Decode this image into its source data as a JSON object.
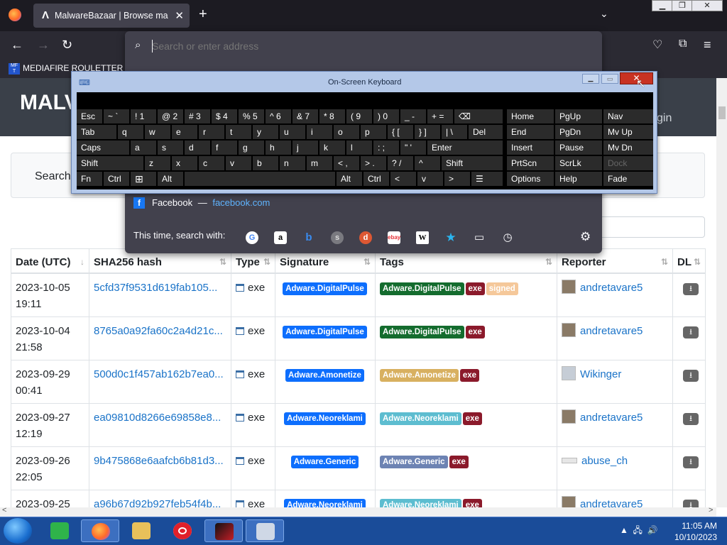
{
  "browser": {
    "tab_title": "MalwareBazaar | Browse malwa",
    "tab_favicon": "Λ",
    "address_placeholder": "Search or enter address",
    "bookmark": "MEDIAFIRE ROULETTER"
  },
  "page": {
    "brand_partial": "MALV",
    "login_partial": "gin",
    "search_label": "Search",
    "table": {
      "headers": [
        "Date (UTC)",
        "SHA256 hash",
        "Type",
        "Signature",
        "Tags",
        "Reporter",
        "DL"
      ],
      "rows": [
        {
          "date": "2023-10-05",
          "time": "19:11",
          "hash": "5cfd37f9531d619fab105...",
          "type": "exe",
          "signature": "Adware.DigitalPulse",
          "tags": [
            "Adware.DigitalPulse",
            "exe",
            "signed"
          ],
          "reporter": "andretavare5"
        },
        {
          "date": "2023-10-04",
          "time": "21:58",
          "hash": "8765a0a92fa60c2a4d21c...",
          "type": "exe",
          "signature": "Adware.DigitalPulse",
          "tags": [
            "Adware.DigitalPulse",
            "exe"
          ],
          "reporter": "andretavare5"
        },
        {
          "date": "2023-09-29",
          "time": "00:41",
          "hash": "500d0c1f457ab162b7ea0...",
          "type": "exe",
          "signature": "Adware.Amonetize",
          "tags": [
            "Adware.Amonetize",
            "exe"
          ],
          "reporter": "Wikinger"
        },
        {
          "date": "2023-09-27",
          "time": "12:19",
          "hash": "ea09810d8266e69858e8...",
          "type": "exe",
          "signature": "Adware.Neoreklami",
          "tags": [
            "Adware.Neoreklami",
            "exe"
          ],
          "reporter": "andretavare5"
        },
        {
          "date": "2023-09-26",
          "time": "22:05",
          "hash": "9b475868e6aafcb6b81d3...",
          "type": "exe",
          "signature": "Adware.Generic",
          "tags": [
            "Adware.Generic",
            "exe"
          ],
          "reporter": "abuse_ch"
        },
        {
          "date": "2023-09-25",
          "time": "",
          "hash": "a96b67d92b927feb54f4b...",
          "type": "exe",
          "signature": "Adware.Neoreklami",
          "tags": [
            "Adware.Neoreklami",
            "exe"
          ],
          "reporter": "andretavare5"
        }
      ]
    }
  },
  "dropdown": {
    "suggestion_name": "Facebook",
    "suggestion_sep": "—",
    "suggestion_url": "facebook.com",
    "search_with": "This time, search with:"
  },
  "osk": {
    "title": "On-Screen Keyboard",
    "rows": [
      [
        "Esc",
        "~ `",
        "! 1",
        "@ 2",
        "# 3",
        "$ 4",
        "% 5",
        "^ 6",
        "& 7",
        "* 8",
        "( 9",
        ") 0",
        "_ -",
        "+ =",
        "⌫"
      ],
      [
        "Tab",
        "q",
        "w",
        "e",
        "r",
        "t",
        "y",
        "u",
        "i",
        "o",
        "p",
        "{ [",
        "} ]",
        "| \\",
        "Del"
      ],
      [
        "Caps",
        "a",
        "s",
        "d",
        "f",
        "g",
        "h",
        "j",
        "k",
        "l",
        ": ;",
        "\" '",
        "Enter"
      ],
      [
        "Shift",
        "z",
        "x",
        "c",
        "v",
        "b",
        "n",
        "m",
        "< ,",
        "> .",
        "? /",
        "^",
        "Shift"
      ],
      [
        "Fn",
        "Ctrl",
        "⊞",
        "Alt",
        "",
        "Alt",
        "Ctrl",
        "<",
        "v",
        ">",
        "☰"
      ]
    ],
    "nav_keys": [
      [
        "Home",
        "PgUp",
        "Nav"
      ],
      [
        "End",
        "PgDn",
        "Mv Up"
      ],
      [
        "Insert",
        "Pause",
        "Mv Dn"
      ],
      [
        "PrtScn",
        "ScrLk",
        "Dock"
      ],
      [
        "Options",
        "Help",
        "Fade"
      ]
    ]
  },
  "taskbar": {
    "time": "11:05 AM",
    "date": "10/10/2023"
  },
  "colors": {
    "browser_dark": "#1c1b22",
    "dropdown": "#42414d",
    "signature_badge": "#0d6efd",
    "exe_badge": "#8b1a2b",
    "taskbar": "#1a4c99"
  }
}
